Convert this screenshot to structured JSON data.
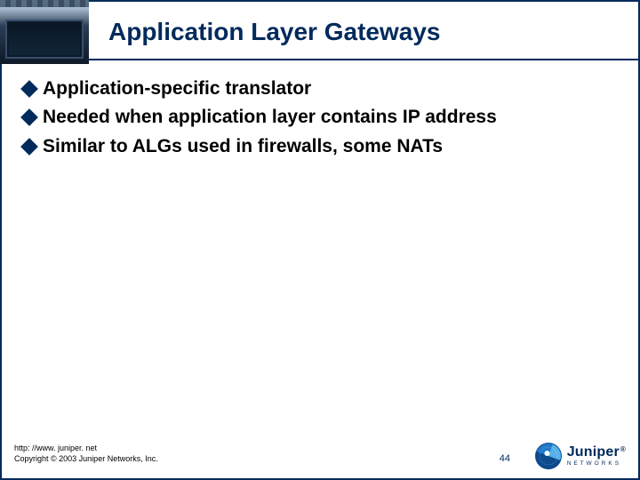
{
  "colors": {
    "primary": "#002a5c"
  },
  "header": {
    "title": "Application Layer Gateways",
    "brand_small": "Juniper"
  },
  "bullets": [
    {
      "text": "Application-specific translator"
    },
    {
      "text": "Needed when application layer contains IP address"
    },
    {
      "text": "Similar to ALGs used in firewalls, some NATs"
    }
  ],
  "footer": {
    "url": "http: //www. juniper. net",
    "copyright": "Copyright © 2003 Juniper Networks, Inc.",
    "slide_number": "44",
    "brand": "Juniper",
    "registered_mark": "®",
    "tagline": "N  E  T  W  O  R  K  S"
  }
}
